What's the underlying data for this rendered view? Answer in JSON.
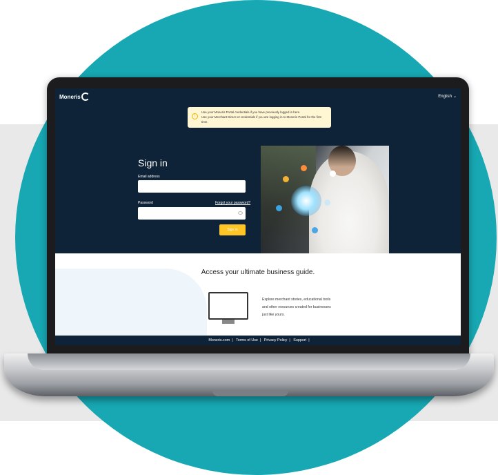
{
  "header": {
    "logo_text": "Moneris",
    "language": "English"
  },
  "notice": {
    "line1": "Use your Moneris Portal credentials if you have previously logged in here.",
    "line2": "Use your Merchant Direct v2 credentials if you are logging in to Moneris Portal for the first time."
  },
  "signin": {
    "title": "Sign in",
    "email_label": "Email address",
    "email_value": "",
    "password_label": "Password",
    "forgot_label": "Forgot your password?",
    "password_value": "",
    "button_label": "Sign in"
  },
  "guide": {
    "title": "Access your ultimate business guide.",
    "description": "Explore merchant stories, educational tools and other resources created for businesses just like yours."
  },
  "footer": {
    "links": [
      "Moneris.com",
      "Terms of Use",
      "Privacy Policy",
      "Support"
    ]
  },
  "colors": {
    "teal": "#17a8b3",
    "navy": "#0e2338",
    "accent_yellow": "#ffc425"
  }
}
